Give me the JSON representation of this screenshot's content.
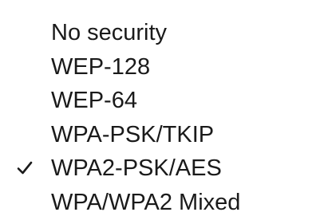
{
  "menu": {
    "items": [
      {
        "label": "No security",
        "checked": false
      },
      {
        "label": "WEP-128",
        "checked": false
      },
      {
        "label": "WEP-64",
        "checked": false
      },
      {
        "label": "WPA-PSK/TKIP",
        "checked": false
      },
      {
        "label": "WPA2-PSK/AES",
        "checked": true
      },
      {
        "label": "WPA/WPA2 Mixed",
        "checked": false
      }
    ],
    "check_icon": "checkmark-icon",
    "text_color": "#1a1a1a",
    "background": "#ffffff"
  }
}
